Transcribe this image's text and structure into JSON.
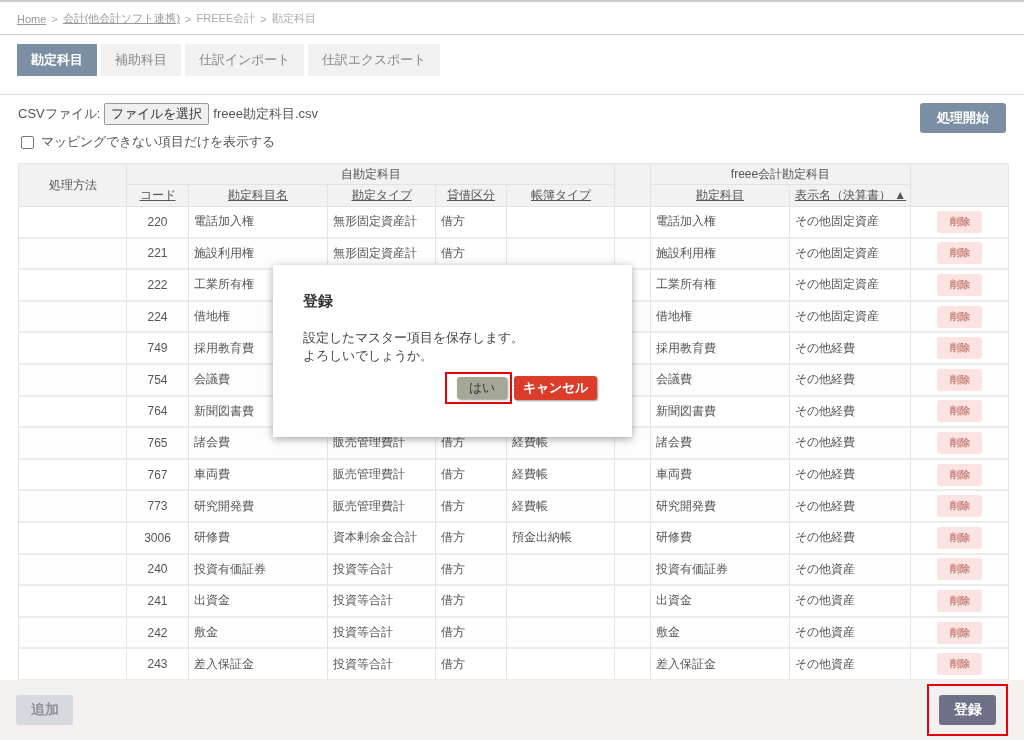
{
  "breadcrumb": [
    {
      "label": "Home",
      "link": true
    },
    {
      "label": "会計(他会計ソフト連携)",
      "link": true,
      "separator": ">"
    },
    {
      "label": "FREEE会計",
      "link": false,
      "separator": ">"
    },
    {
      "label": "勘定科目",
      "link": false,
      "separator": ">"
    }
  ],
  "tabs": [
    {
      "label": "勘定科目",
      "selected": true
    },
    {
      "label": "補助科目",
      "selected": false
    },
    {
      "label": "仕訳インポート",
      "selected": false
    },
    {
      "label": "仕訳エクスポート",
      "selected": false
    }
  ],
  "csv": {
    "label": "CSVファイル:",
    "button": "ファイルを選択",
    "file": "freee勘定科目.csv"
  },
  "start_button": "処理開始",
  "filter": {
    "label": "マッピングできない項目だけを表示する",
    "checked": false
  },
  "table": {
    "method_header": "処理方法",
    "own_group": "自勘定科目",
    "freee_group": "freee会計勘定科目",
    "own_columns": [
      {
        "label": "コード"
      },
      {
        "label": "勘定科目名"
      },
      {
        "label": "勘定タイプ"
      },
      {
        "label": "貸借区分"
      },
      {
        "label": "帳簿タイプ"
      }
    ],
    "freee_columns": [
      {
        "label": "勘定科目"
      },
      {
        "label": "表示名（決算書）",
        "sort_mark": "▲"
      }
    ],
    "rows": [
      {
        "code": "220",
        "name": "電話加入権",
        "type": "無形固定資産計",
        "side": "借方",
        "freee_name": "電話加入権",
        "display": "その他固定資産",
        "delete": "削除",
        "delete_disabled": true
      },
      {
        "code": "221",
        "name": "施設利用権",
        "type": "無形固定資産計",
        "side": "借方",
        "freee_name": "施設利用権",
        "display": "その他固定資産",
        "delete": "削除",
        "delete_disabled": true
      },
      {
        "code": "222",
        "name": "工業所有権",
        "freee_name": "工業所有権",
        "display": "その他固定資産",
        "delete": "削除",
        "delete_disabled": true
      },
      {
        "code": "224",
        "name": "借地権",
        "freee_name": "借地権",
        "display": "その他固定資産",
        "delete": "削除",
        "delete_disabled": true
      },
      {
        "code": "749",
        "name": "採用教育費",
        "freee_name": "採用教育費",
        "display": "その他経費",
        "delete": "削除",
        "delete_disabled": true
      },
      {
        "code": "754",
        "name": "会議費",
        "freee_name": "会議費",
        "display": "その他経費",
        "delete": "削除",
        "delete_disabled": true
      },
      {
        "code": "764",
        "name": "新聞図書費",
        "freee_name": "新聞図書費",
        "display": "その他経費",
        "delete": "削除",
        "delete_disabled": true
      },
      {
        "code": "765",
        "name": "諸会費",
        "type": "販売管理費計",
        "side": "借方",
        "book": "経費帳",
        "freee_name": "諸会費",
        "display": "その他経費",
        "delete": "削除",
        "delete_disabled": true
      },
      {
        "code": "767",
        "name": "車両費",
        "type": "販売管理費計",
        "side": "借方",
        "book": "経費帳",
        "freee_name": "車両費",
        "display": "その他経費",
        "delete": "削除",
        "delete_disabled": true
      },
      {
        "code": "773",
        "name": "研究開発費",
        "type": "販売管理費計",
        "side": "借方",
        "book": "経費帳",
        "freee_name": "研究開発費",
        "display": "その他経費",
        "delete": "削除",
        "delete_disabled": true
      },
      {
        "code": "3006",
        "name": "研修費",
        "type": "資本剰余金合計",
        "side": "借方",
        "book": "預金出納帳",
        "freee_name": "研修費",
        "display": "その他経費",
        "delete": "削除",
        "delete_disabled": true
      },
      {
        "code": "240",
        "name": "投資有価証券",
        "type": "投資等合計",
        "side": "借方",
        "freee_name": "投資有価証券",
        "display": "その他資産",
        "delete": "削除",
        "delete_disabled": true
      },
      {
        "code": "241",
        "name": "出資金",
        "type": "投資等合計",
        "side": "借方",
        "freee_name": "出資金",
        "display": "その他資産",
        "delete": "削除",
        "delete_disabled": true
      },
      {
        "code": "242",
        "name": "敷金",
        "type": "投資等合計",
        "side": "借方",
        "freee_name": "敷金",
        "display": "その他資産",
        "delete": "削除",
        "delete_disabled": true
      },
      {
        "code": "243",
        "name": "差入保証金",
        "type": "投資等合計",
        "side": "借方",
        "freee_name": "差入保証金",
        "display": "その他資産",
        "delete": "削除",
        "delete_disabled": true
      }
    ]
  },
  "dialog": {
    "title": "登録",
    "message": [
      "設定したマスター項目を保存します。",
      "よろしいでしょうか。"
    ],
    "yes": {
      "label": "はい",
      "highlighted": true
    },
    "cancel": {
      "label": "キャンセル",
      "highlighted": false
    }
  },
  "footer": {
    "add": {
      "label": "追加",
      "disabled": true
    },
    "register": {
      "label": "登録",
      "highlighted": true
    }
  }
}
